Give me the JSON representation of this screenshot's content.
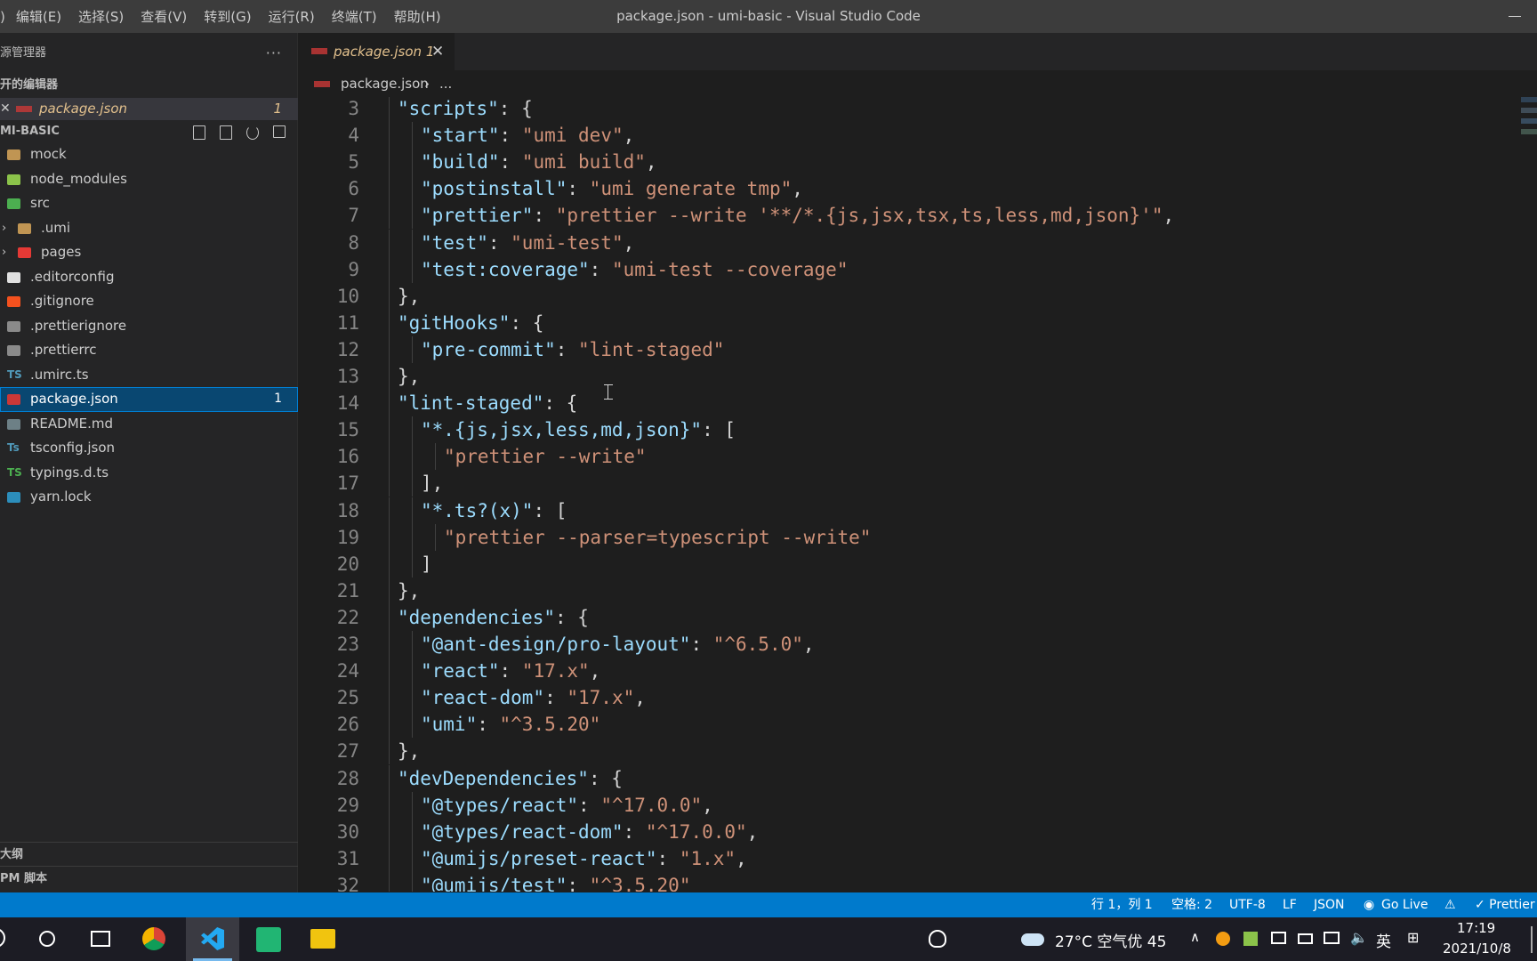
{
  "titlebar": {
    "menus": [
      ")",
      "编辑(E)",
      "选择(S)",
      "查看(V)",
      "转到(G)",
      "运行(R)",
      "终端(T)",
      "帮助(H)"
    ],
    "window_title": "package.json - umi-basic - Visual Studio Code"
  },
  "sidebar": {
    "header": "源管理器",
    "more": "···",
    "open_editors_title": "开的编辑器",
    "open_editor": {
      "name": "package.json",
      "problems": "1"
    },
    "project_title": "MI-BASIC",
    "files": [
      {
        "name": "mock",
        "icon": "folder-icon",
        "color": "#c09553",
        "indent": 0
      },
      {
        "name": "node_modules",
        "icon": "node-modules-folder-icon",
        "color": "#8bc34a",
        "indent": 0
      },
      {
        "name": "src",
        "icon": "src-folder-icon",
        "color": "#4caf50",
        "indent": 0
      },
      {
        "name": ".umi",
        "icon": "folder-icon",
        "color": "#c09553",
        "indent": 1,
        "chevron": "›"
      },
      {
        "name": "pages",
        "icon": "pages-folder-icon",
        "color": "#e53935",
        "indent": 1,
        "chevron": "›"
      },
      {
        "name": ".editorconfig",
        "icon": "editorconfig-icon",
        "color": "#e0e0e0",
        "indent": 0
      },
      {
        "name": ".gitignore",
        "icon": "git-icon",
        "color": "#f4511e",
        "indent": 0
      },
      {
        "name": ".prettierignore",
        "icon": "prettier-icon",
        "color": "#8a8a8a",
        "indent": 0
      },
      {
        "name": ".prettierrc",
        "icon": "prettier-icon",
        "color": "#8a8a8a",
        "indent": 0
      },
      {
        "name": ".umirc.ts",
        "icon": "ts-icon",
        "text": "TS",
        "color": "#519aba",
        "indent": 0
      },
      {
        "name": "package.json",
        "icon": "npm-icon",
        "color": "#cb3837",
        "indent": 0,
        "selected": true,
        "badge": "1"
      },
      {
        "name": "README.md",
        "icon": "markdown-icon",
        "color": "#6d8086",
        "indent": 0
      },
      {
        "name": "tsconfig.json",
        "icon": "tsconfig-icon",
        "text": "Ts",
        "color": "#519aba",
        "indent": 0
      },
      {
        "name": "typings.d.ts",
        "icon": "ts-def-icon",
        "text": "TS",
        "color": "#4caf50",
        "indent": 0
      },
      {
        "name": "yarn.lock",
        "icon": "yarn-icon",
        "color": "#2c8ebb",
        "indent": 0
      }
    ],
    "outline_title": "大纲",
    "npm_title": "PM 脚本"
  },
  "tab": {
    "name": "package.json",
    "problems": "1",
    "close": "✕"
  },
  "breadcrumb": {
    "file": "package.json",
    "separator": "›",
    "rest": "..."
  },
  "code_lines": [
    {
      "n": "3",
      "i": 1,
      "t": [
        [
          "k",
          "\"scripts\""
        ],
        [
          "p",
          ": {"
        ]
      ]
    },
    {
      "n": "4",
      "i": 2,
      "t": [
        [
          "k",
          "\"start\""
        ],
        [
          "p",
          ": "
        ],
        [
          "s",
          "\"umi dev\""
        ],
        [
          "p",
          ","
        ]
      ]
    },
    {
      "n": "5",
      "i": 2,
      "t": [
        [
          "k",
          "\"build\""
        ],
        [
          "p",
          ": "
        ],
        [
          "s",
          "\"umi build\""
        ],
        [
          "p",
          ","
        ]
      ]
    },
    {
      "n": "6",
      "i": 2,
      "t": [
        [
          "k",
          "\"postinstall\""
        ],
        [
          "p",
          ": "
        ],
        [
          "s",
          "\"umi generate tmp\""
        ],
        [
          "p",
          ","
        ]
      ]
    },
    {
      "n": "7",
      "i": 2,
      "t": [
        [
          "k",
          "\"prettier\""
        ],
        [
          "p",
          ": "
        ],
        [
          "s",
          "\"prettier --write '**/*.{js,jsx,tsx,ts,less,md,json}'\""
        ],
        [
          "p",
          ","
        ]
      ]
    },
    {
      "n": "8",
      "i": 2,
      "t": [
        [
          "k",
          "\"test\""
        ],
        [
          "p",
          ": "
        ],
        [
          "s",
          "\"umi-test\""
        ],
        [
          "p",
          ","
        ]
      ]
    },
    {
      "n": "9",
      "i": 2,
      "t": [
        [
          "k",
          "\"test:coverage\""
        ],
        [
          "p",
          ": "
        ],
        [
          "s",
          "\"umi-test --coverage\""
        ]
      ]
    },
    {
      "n": "10",
      "i": 1,
      "t": [
        [
          "p",
          "},"
        ]
      ]
    },
    {
      "n": "11",
      "i": 1,
      "t": [
        [
          "k",
          "\"gitHooks\""
        ],
        [
          "p",
          ": {"
        ]
      ]
    },
    {
      "n": "12",
      "i": 2,
      "t": [
        [
          "k",
          "\"pre-commit\""
        ],
        [
          "p",
          ": "
        ],
        [
          "s",
          "\"lint-staged\""
        ]
      ]
    },
    {
      "n": "13",
      "i": 1,
      "t": [
        [
          "p",
          "},"
        ]
      ]
    },
    {
      "n": "14",
      "i": 1,
      "t": [
        [
          "k",
          "\"lint-staged\""
        ],
        [
          "p",
          ": {"
        ]
      ]
    },
    {
      "n": "15",
      "i": 2,
      "t": [
        [
          "k",
          "\"*.{js,jsx,less,md,json}\""
        ],
        [
          "p",
          ": ["
        ]
      ]
    },
    {
      "n": "16",
      "i": 3,
      "t": [
        [
          "s",
          "\"prettier --write\""
        ]
      ]
    },
    {
      "n": "17",
      "i": 2,
      "t": [
        [
          "p",
          "],"
        ]
      ]
    },
    {
      "n": "18",
      "i": 2,
      "t": [
        [
          "k",
          "\"*.ts?(x)\""
        ],
        [
          "p",
          ": ["
        ]
      ]
    },
    {
      "n": "19",
      "i": 3,
      "t": [
        [
          "s",
          "\"prettier --parser=typescript --write\""
        ]
      ]
    },
    {
      "n": "20",
      "i": 2,
      "t": [
        [
          "p",
          "]"
        ]
      ]
    },
    {
      "n": "21",
      "i": 1,
      "t": [
        [
          "p",
          "},"
        ]
      ]
    },
    {
      "n": "22",
      "i": 1,
      "t": [
        [
          "k",
          "\"dependencies\""
        ],
        [
          "p",
          ": {"
        ]
      ]
    },
    {
      "n": "23",
      "i": 2,
      "t": [
        [
          "k",
          "\"@ant-design/pro-layout\""
        ],
        [
          "p",
          ": "
        ],
        [
          "s",
          "\"^6.5.0\""
        ],
        [
          "p",
          ","
        ]
      ]
    },
    {
      "n": "24",
      "i": 2,
      "t": [
        [
          "k",
          "\"react\""
        ],
        [
          "p",
          ": "
        ],
        [
          "s",
          "\"17.x\""
        ],
        [
          "p",
          ","
        ]
      ]
    },
    {
      "n": "25",
      "i": 2,
      "t": [
        [
          "k",
          "\"react-dom\""
        ],
        [
          "p",
          ": "
        ],
        [
          "s",
          "\"17.x\""
        ],
        [
          "p",
          ","
        ]
      ]
    },
    {
      "n": "26",
      "i": 2,
      "t": [
        [
          "k",
          "\"umi\""
        ],
        [
          "p",
          ": "
        ],
        [
          "s",
          "\"^3.5.20\""
        ]
      ]
    },
    {
      "n": "27",
      "i": 1,
      "t": [
        [
          "p",
          "},"
        ]
      ]
    },
    {
      "n": "28",
      "i": 1,
      "t": [
        [
          "k",
          "\"devDependencies\""
        ],
        [
          "p",
          ": {"
        ]
      ]
    },
    {
      "n": "29",
      "i": 2,
      "t": [
        [
          "k",
          "\"@types/react\""
        ],
        [
          "p",
          ": "
        ],
        [
          "s",
          "\"^17.0.0\""
        ],
        [
          "p",
          ","
        ]
      ]
    },
    {
      "n": "30",
      "i": 2,
      "t": [
        [
          "k",
          "\"@types/react-dom\""
        ],
        [
          "p",
          ": "
        ],
        [
          "s",
          "\"^17.0.0\""
        ],
        [
          "p",
          ","
        ]
      ]
    },
    {
      "n": "31",
      "i": 2,
      "t": [
        [
          "k",
          "\"@umijs/preset-react\""
        ],
        [
          "p",
          ": "
        ],
        [
          "s",
          "\"1.x\""
        ],
        [
          "p",
          ","
        ]
      ]
    },
    {
      "n": "32",
      "i": 2,
      "t": [
        [
          "k",
          "\"@umijs/test\""
        ],
        [
          "p",
          ": "
        ],
        [
          "s",
          "\"^3.5.20\""
        ]
      ]
    }
  ],
  "statusbar": {
    "position": "行 1，列 1",
    "spaces": "空格: 2",
    "encoding": "UTF-8",
    "eol": "LF",
    "language": "JSON",
    "golive": "Go Live",
    "prettier": "✓ Prettier"
  },
  "taskbar": {
    "weather": "27°C 空气优 45",
    "ime": "英",
    "time": "17:19",
    "date": "2021/10/8"
  },
  "colors": {
    "accent": "#007acc",
    "selection": "#094771",
    "modified": "#e2c08d"
  }
}
